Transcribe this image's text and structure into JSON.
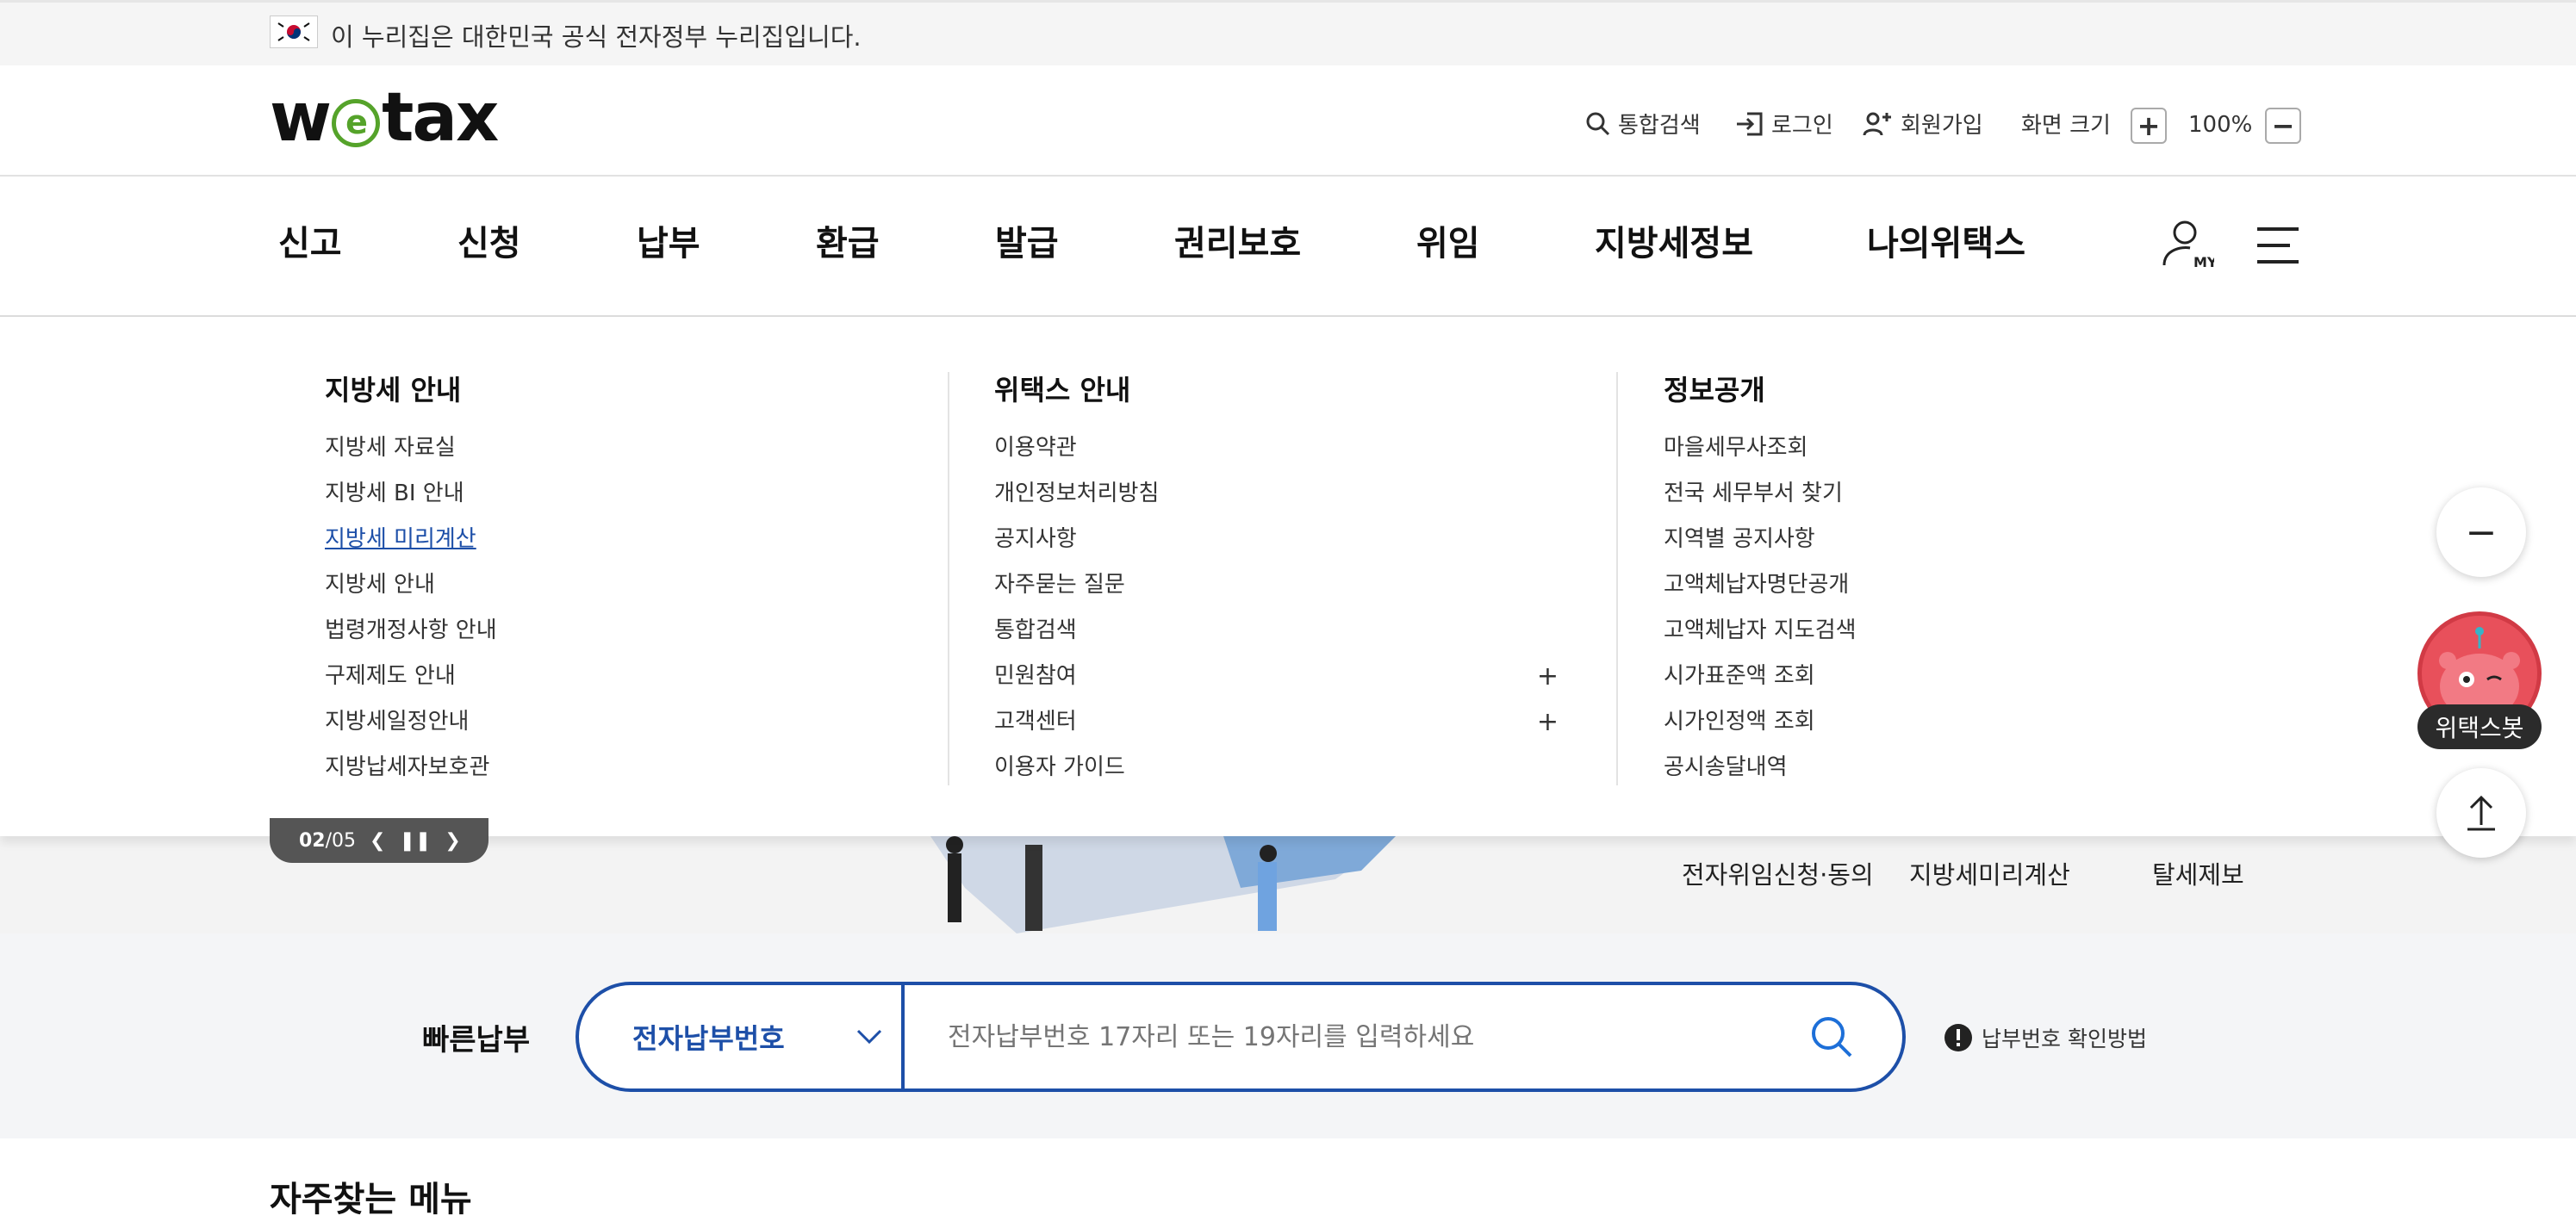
{
  "gov_notice": {
    "text": "이 누리집은 대한민국 공식 전자정부 누리집입니다."
  },
  "header": {
    "logo": {
      "pre": "w",
      "e": "e",
      "post": "tax"
    },
    "search": "통합검색",
    "login": "로그인",
    "signup": "회원가입",
    "screen_size_label": "화면 크기",
    "zoom_in": "+",
    "zoom_level": "100%",
    "zoom_out": "−"
  },
  "gnb": {
    "items": [
      "신고",
      "신청",
      "납부",
      "환급",
      "발급",
      "권리보호",
      "위임",
      "지방세정보",
      "나의위택스"
    ],
    "my_label": "MY"
  },
  "mega_menu": {
    "columns": [
      {
        "title": "지방세 안내",
        "items": [
          "지방세 자료실",
          "지방세 BI 안내",
          "지방세 미리계산",
          "지방세 안내",
          "법령개정사항 안내",
          "구제제도 안내",
          "지방세일정안내",
          "지방납세자보호관"
        ]
      },
      {
        "title": "위택스 안내",
        "items": [
          "이용약관",
          "개인정보처리방침",
          "공지사항",
          "자주묻는 질문",
          "통합검색",
          "민원참여",
          "고객센터",
          "이용자 가이드"
        ],
        "expand_symbol": "+"
      },
      {
        "title": "정보공개",
        "items": [
          "마을세무사조회",
          "전국 세무부서 찾기",
          "지역별 공지사항",
          "고액체납자명단공개",
          "고액체납자 지도검색",
          "시가표준액 조회",
          "시가인정액 조회",
          "공시송달내역"
        ]
      }
    ]
  },
  "banner": {
    "pager": {
      "current": "02",
      "separator": "/",
      "total": "05"
    },
    "quick_links": [
      "전자위임신청·동의",
      "지방세미리계산",
      "탈세제보"
    ]
  },
  "quick_pay": {
    "title": "빠른납부",
    "select_value": "전자납부번호",
    "input_placeholder": "전자납부번호 17자리 또는 19자리를 입력하세요",
    "help_text": "납부번호 확인방법"
  },
  "favorites": {
    "title": "자주찾는 메뉴"
  },
  "floating": {
    "bot_label": "위택스봇",
    "collapse": "−"
  }
}
